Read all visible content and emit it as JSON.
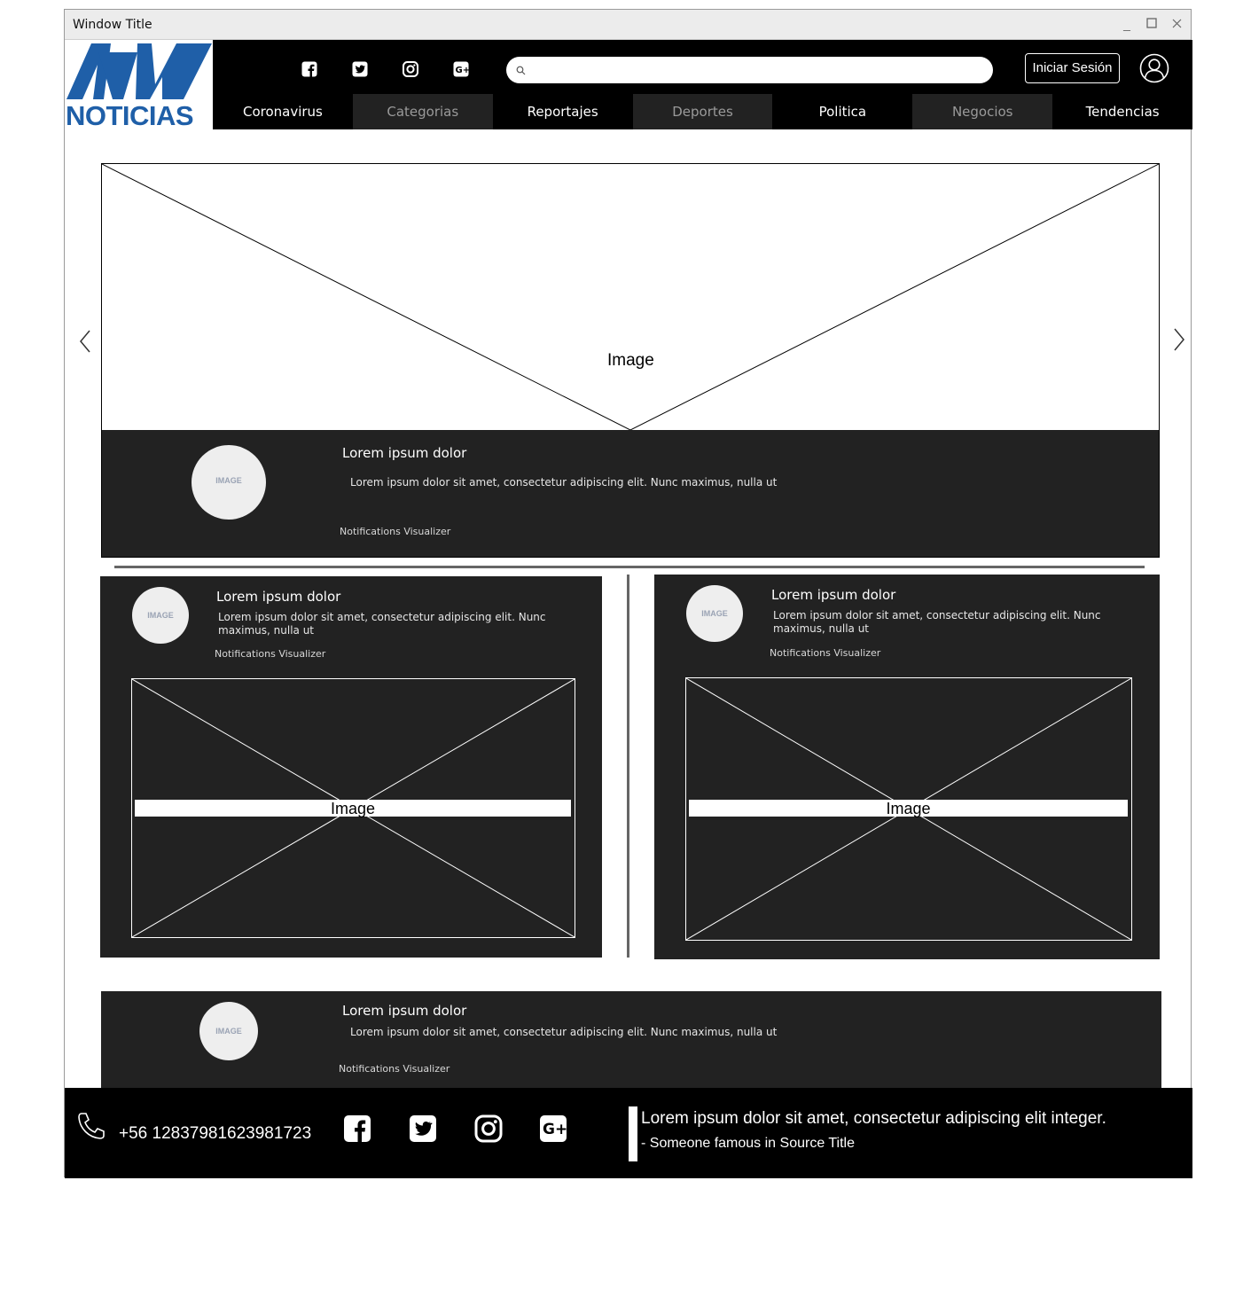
{
  "window": {
    "title": "Window Title"
  },
  "brand": {
    "name": "NOTICIAS",
    "color": "#1f5fa8"
  },
  "header": {
    "social_icons": [
      "facebook-icon",
      "twitter-icon",
      "instagram-icon",
      "google-plus-icon"
    ],
    "search": {
      "placeholder": ""
    },
    "login_label": "Iniciar Sesión"
  },
  "nav": {
    "items": [
      "Coronavirus",
      "Categorias",
      "Reportajes",
      "Deportes",
      "Politica",
      "Negocios",
      "Tendencias"
    ]
  },
  "hero": {
    "image_label": "Image",
    "avatar_label": "IMAGE",
    "title": "Lorem ipsum dolor",
    "body": "Lorem ipsum dolor sit amet, consectetur adipiscing elit. Nunc maximus, nulla ut",
    "notifications": "Notifications Visualizer"
  },
  "cards": [
    {
      "avatar_label": "IMAGE",
      "title": "Lorem ipsum dolor",
      "body": "Lorem ipsum dolor sit amet, consectetur adipiscing elit. Nunc maximus, nulla ut",
      "notifications": "Notifications Visualizer",
      "image_label": "Image"
    },
    {
      "avatar_label": "IMAGE",
      "title": "Lorem ipsum dolor",
      "body": "Lorem ipsum dolor sit amet, consectetur adipiscing elit. Nunc maximus, nulla ut",
      "notifications": "Notifications Visualizer",
      "image_label": "Image"
    }
  ],
  "bottom_card": {
    "avatar_label": "IMAGE",
    "title": "Lorem ipsum dolor",
    "body": "Lorem ipsum dolor sit amet, consectetur adipiscing elit. Nunc maximus, nulla ut",
    "notifications": "Notifications Visualizer"
  },
  "footer": {
    "phone": "+56 12837981623981723",
    "social_icons": [
      "facebook-icon",
      "twitter-icon",
      "instagram-icon",
      "google-plus-icon"
    ],
    "quote": "Lorem ipsum dolor sit amet, consectetur adipiscing elit integer.",
    "quote_source": "- Someone famous in Source Title"
  }
}
